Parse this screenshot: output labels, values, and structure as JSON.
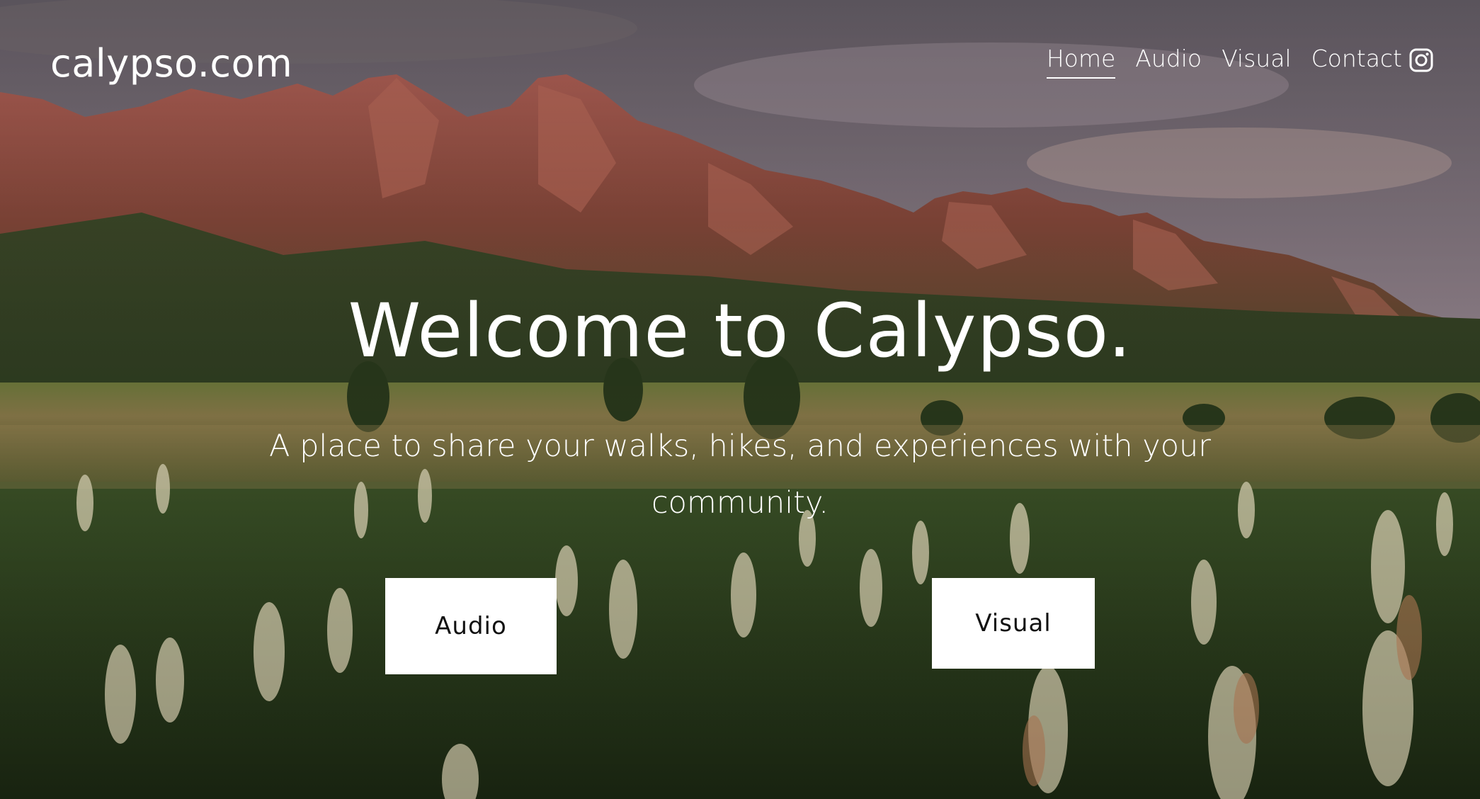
{
  "site": {
    "title": "calypso.com"
  },
  "nav": {
    "items": [
      {
        "label": "Home",
        "active": true
      },
      {
        "label": "Audio",
        "active": false
      },
      {
        "label": "Visual",
        "active": false
      },
      {
        "label": "Contact",
        "active": false
      }
    ],
    "social_icon": "instagram-icon"
  },
  "hero": {
    "headline": "Welcome to Calypso.",
    "tagline": "A place to share your walks, hikes, and experiences with your community.",
    "buttons": {
      "audio_label": "Audio",
      "visual_label": "Visual"
    }
  },
  "colors": {
    "text": "#ffffff",
    "button_bg": "#ffffff",
    "button_text": "#111111"
  }
}
